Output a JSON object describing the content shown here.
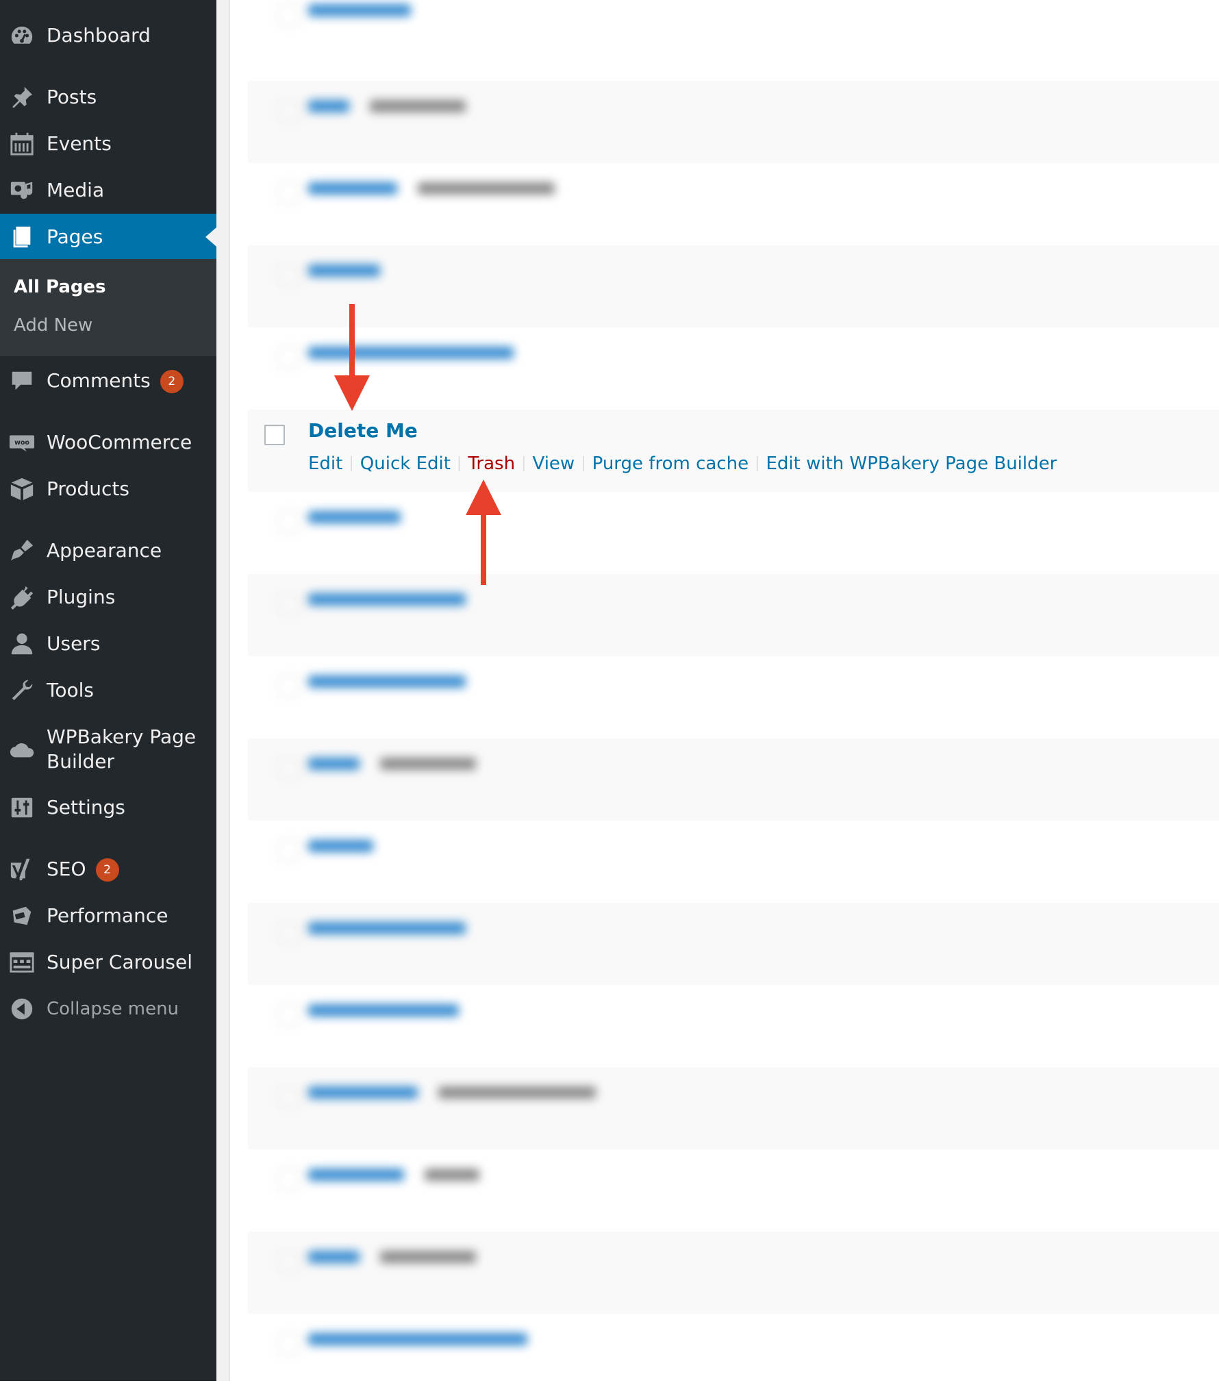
{
  "sidebar": {
    "items": [
      {
        "key": "dashboard",
        "label": "Dashboard",
        "icon": "dashboard-icon"
      },
      {
        "key": "posts",
        "label": "Posts",
        "icon": "pushpin-icon"
      },
      {
        "key": "events",
        "label": "Events",
        "icon": "calendar-icon"
      },
      {
        "key": "media",
        "label": "Media",
        "icon": "media-icon"
      },
      {
        "key": "pages",
        "label": "Pages",
        "icon": "pages-icon",
        "active": true
      },
      {
        "key": "comments",
        "label": "Comments",
        "icon": "comment-icon",
        "badge": "2"
      },
      {
        "key": "woocommerce",
        "label": "WooCommerce",
        "icon": "woo-icon"
      },
      {
        "key": "products",
        "label": "Products",
        "icon": "box-icon"
      },
      {
        "key": "appearance",
        "label": "Appearance",
        "icon": "paintbrush-icon"
      },
      {
        "key": "plugins",
        "label": "Plugins",
        "icon": "plug-icon"
      },
      {
        "key": "users",
        "label": "Users",
        "icon": "user-icon"
      },
      {
        "key": "tools",
        "label": "Tools",
        "icon": "wrench-icon"
      },
      {
        "key": "wpbakery",
        "label_line1": "WPBakery Page",
        "label_line2": "Builder",
        "icon": "cloud-icon"
      },
      {
        "key": "settings",
        "label": "Settings",
        "icon": "sliders-icon"
      },
      {
        "key": "seo",
        "label": "SEO",
        "icon": "yoast-icon",
        "badge": "2"
      },
      {
        "key": "performance",
        "label": "Performance",
        "icon": "performance-icon"
      },
      {
        "key": "super-carousel",
        "label": "Super Carousel",
        "icon": "carousel-icon"
      },
      {
        "key": "collapse",
        "label": "Collapse menu",
        "icon": "collapse-arrow-icon"
      }
    ],
    "submenu": {
      "all_pages": "All Pages",
      "add_new": "Add New"
    }
  },
  "focus_row": {
    "title": "Delete Me",
    "actions": {
      "edit": "Edit",
      "quick_edit": "Quick Edit",
      "trash": "Trash",
      "view": "View",
      "purge": "Purge from cache",
      "wpbakery": "Edit with WPBakery Page Builder"
    }
  },
  "colors": {
    "sidebar_bg": "#23282d",
    "active_bg": "#0073aa",
    "link": "#0073aa",
    "trash": "#aa0000",
    "annotation_arrow": "#e8402a",
    "badge": "#ca4a1f"
  }
}
